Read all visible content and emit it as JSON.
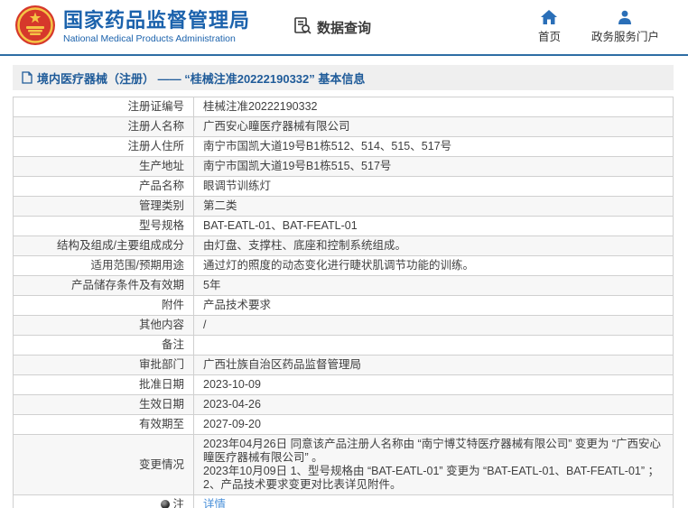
{
  "header": {
    "logo": {
      "icon": "nmpa-emblem",
      "title_cn": "国家药品监督管理局",
      "title_en": "National Medical Products Administration"
    },
    "data_query_label": "数据查询",
    "nav": [
      {
        "icon": "home-icon",
        "label": "首页"
      },
      {
        "icon": "user-icon",
        "label": "政务服务门户"
      }
    ]
  },
  "breadcrumb": {
    "text": "境内医疗器械（注册） —— “桂械注准20222190332” 基本信息"
  },
  "table": {
    "rows": [
      {
        "label": "注册证编号",
        "value": "桂械注准20222190332"
      },
      {
        "label": "注册人名称",
        "value": "广西安心瞳医疗器械有限公司"
      },
      {
        "label": "注册人住所",
        "value": "南宁市国凯大道19号B1栋512、514、515、517号"
      },
      {
        "label": "生产地址",
        "value": "南宁市国凯大道19号B1栋515、517号"
      },
      {
        "label": "产品名称",
        "value": "眼调节训练灯"
      },
      {
        "label": "管理类别",
        "value": "第二类"
      },
      {
        "label": "型号规格",
        "value": "BAT-EATL-01、BAT-FEATL-01"
      },
      {
        "label": "结构及组成/主要组成成分",
        "value": "由灯盘、支撑柱、底座和控制系统组成。"
      },
      {
        "label": "适用范围/预期用途",
        "value": "通过灯的照度的动态变化进行睫状肌调节功能的训练。"
      },
      {
        "label": "产品储存条件及有效期",
        "value": "5年"
      },
      {
        "label": "附件",
        "value": "产品技术要求"
      },
      {
        "label": "其他内容",
        "value": "/"
      },
      {
        "label": "备注",
        "value": ""
      },
      {
        "label": "审批部门",
        "value": "广西壮族自治区药品监督管理局"
      },
      {
        "label": "批准日期",
        "value": "2023-10-09"
      },
      {
        "label": "生效日期",
        "value": "2023-04-26"
      },
      {
        "label": "有效期至",
        "value": "2027-09-20"
      },
      {
        "label": "变更情况",
        "value": [
          "2023年04月26日 同意该产品注册人名称由 “南宁博艾特医疗器械有限公司” 变更为 “广西安心瞳医疗器械有限公司” 。",
          "2023年10月09日 1、型号规格由 “BAT-EATL-01” 变更为 “BAT-EATL-01、BAT-FEATL-01” ；2、产品技术要求变更对比表详见附件。"
        ]
      },
      {
        "label": "注",
        "label_icon": "note-bullet-icon",
        "value": "详情",
        "link": true
      }
    ]
  },
  "colors": {
    "brand_blue": "#1b62ac",
    "nav_icon_blue": "#2a6fb8",
    "separator_blue": "#2e6da4",
    "breadcrumb_text": "#1f5b99",
    "breadcrumb_bg": "#efefef",
    "link_blue": "#4a90d9",
    "row_alt_bg": "#f7f7f7",
    "table_border": "#d0d0d0",
    "emblem_red": "#d6382b",
    "emblem_gold": "#f5c445"
  }
}
